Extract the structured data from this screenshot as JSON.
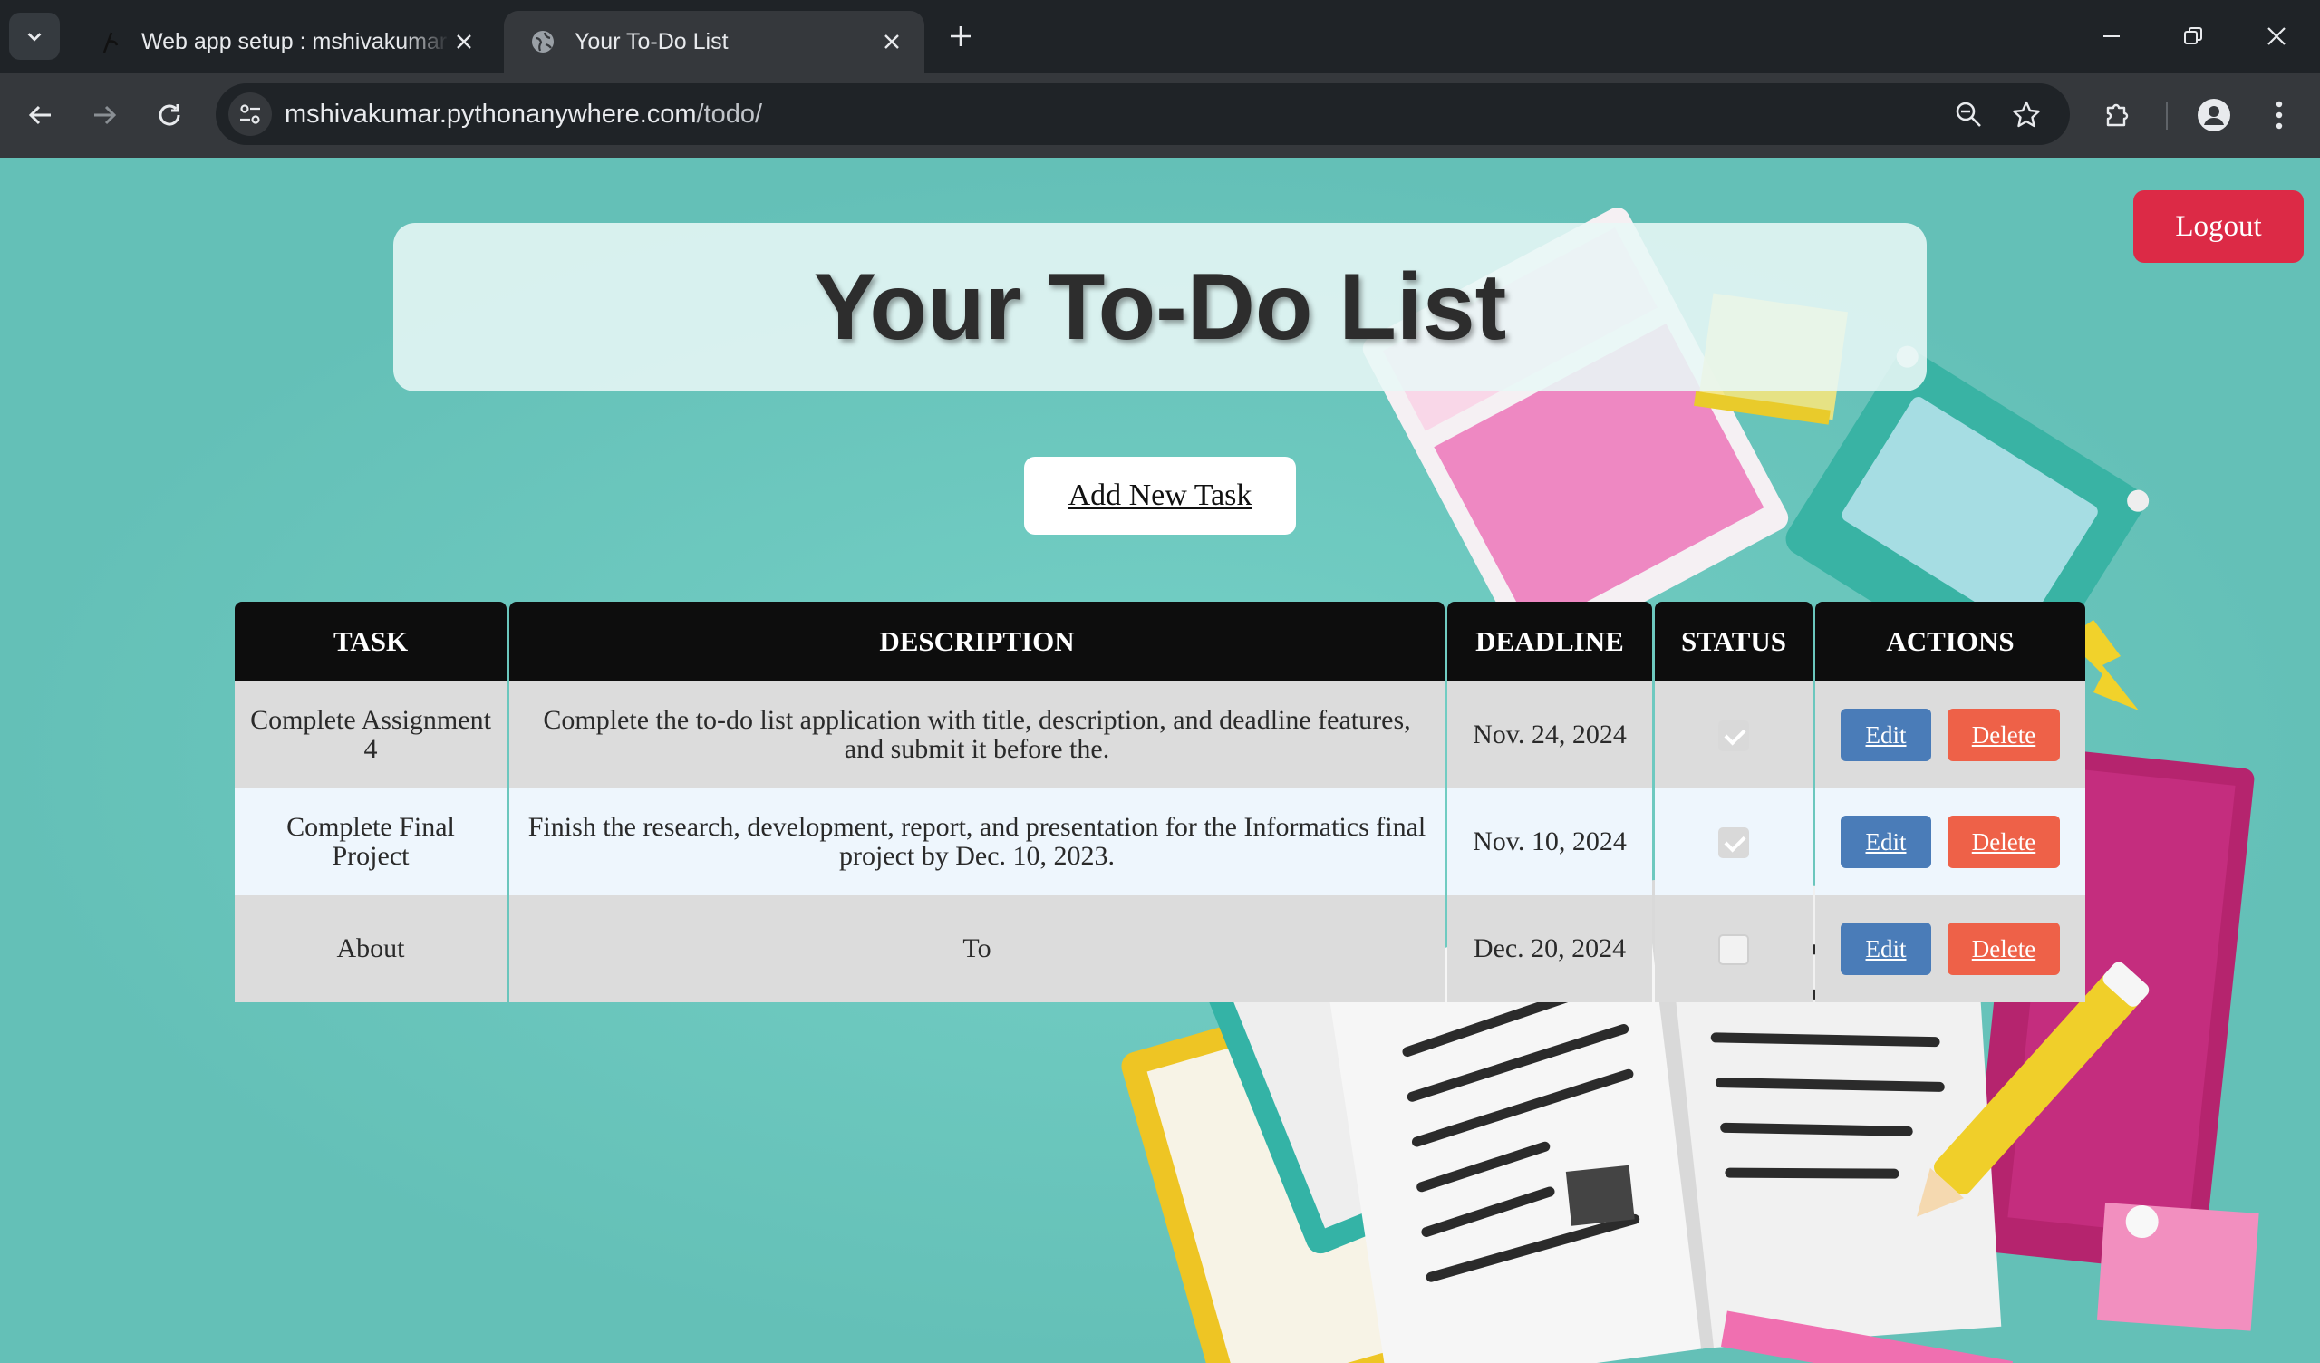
{
  "browser": {
    "tabs": [
      {
        "title": "Web app setup : mshivakumar : PythonAnywhere",
        "active": false
      },
      {
        "title": "Your To-Do List",
        "active": true
      }
    ],
    "url_host": "mshivakumar.pythonanywhere.com",
    "url_path": "/todo/"
  },
  "page": {
    "logout_label": "Logout",
    "heading": "Your To-Do List",
    "add_task_label": "Add New Task",
    "table": {
      "headers": [
        "TASK",
        "DESCRIPTION",
        "DEADLINE",
        "STATUS",
        "ACTIONS"
      ],
      "rows": [
        {
          "task": "Complete Assignment 4",
          "description": "Complete the to-do list application with title, description, and deadline features, and submit it before the.",
          "deadline": "Nov. 24, 2024",
          "done": true,
          "edit": "Edit",
          "delete": "Delete"
        },
        {
          "task": "Complete Final Project",
          "description": "Finish the research, development, report, and presentation for the Informatics final project by Dec. 10, 2023.",
          "deadline": "Nov. 10, 2024",
          "done": true,
          "edit": "Edit",
          "delete": "Delete"
        },
        {
          "task": "About",
          "description": "To",
          "deadline": "Dec. 20, 2024",
          "done": false,
          "edit": "Edit",
          "delete": "Delete"
        }
      ]
    }
  },
  "colors": {
    "background": "#64c0b7",
    "logout": "#dc2a46",
    "edit": "#4a7cb8",
    "delete": "#ee6148",
    "header_bg": "#0d0d0d"
  }
}
